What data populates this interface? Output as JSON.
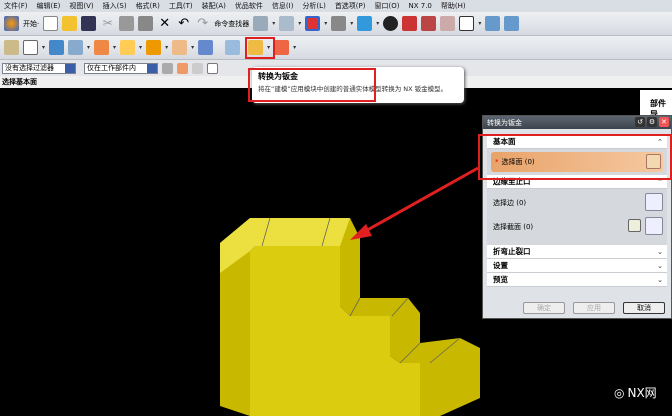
{
  "menu": [
    "文件(F)",
    "编辑(E)",
    "视图(V)",
    "插入(S)",
    "格式(R)",
    "工具(T)",
    "装配(A)",
    "优品软件",
    "信息(I)",
    "分析(L)",
    "首选项(P)",
    "窗口(O)",
    "NX 7.0",
    "帮助(H)"
  ],
  "toolbar": {
    "start_label": "开始·",
    "command_finder": "命令查找器"
  },
  "selection": {
    "filter": "没有选择过滤器",
    "scope": "仅在工作部件内"
  },
  "status": "选择基本面",
  "tooltip": {
    "title": "转换为钣金",
    "body": "将在“建模”应用模块中创建的普通实体模型转换为 NX 钣金模型。"
  },
  "side_panel": {
    "title": "部件导"
  },
  "dialog": {
    "title": "转换为钣金",
    "sections": {
      "base_face": "基本面",
      "edge_rip": "边缘至止口",
      "bend_relief": "折弯止裂口",
      "settings": "设置",
      "preview": "预览"
    },
    "select_face": "选择面 (0)",
    "select_edge": "选择边 (0)",
    "select_section": "选择截面 (0)",
    "buttons": {
      "ok": "确定",
      "apply": "应用",
      "cancel": "取消"
    }
  },
  "watermark": "NX网",
  "colors": {
    "part": "#d4c400",
    "highlight": "#e02020",
    "selected_row": "#e9a36a"
  }
}
